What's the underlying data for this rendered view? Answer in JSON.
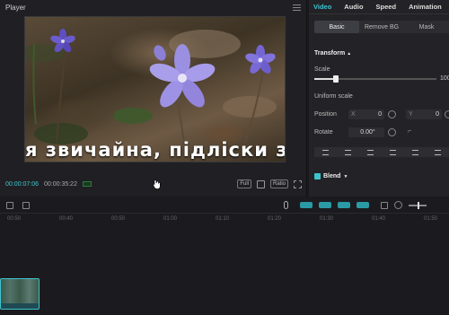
{
  "player": {
    "title": "Player",
    "subtitle": "я звичайна, підліски зв",
    "time_current": "00:00:07:06",
    "time_total": "00:00:35:22",
    "full_label": "Full",
    "ratio_label": "Ratio"
  },
  "inspector": {
    "tabs": [
      "Video",
      "Audio",
      "Speed",
      "Animation",
      "A"
    ],
    "subtabs": [
      "Basic",
      "Remove BG",
      "Mask"
    ],
    "transform_title": "Transform",
    "scale_label": "Scale",
    "scale_value": "100",
    "scale_fraction": 0.18,
    "uniform_scale_label": "Uniform scale",
    "position_label": "Position",
    "pos_x_label": "X",
    "pos_x_value": "0",
    "pos_y_label": "Y",
    "pos_y_value": "0",
    "rotate_label": "Rotate",
    "rotate_value": "0.00°",
    "blend_label": "Blend"
  },
  "timeline": {
    "ruler": [
      "00:50",
      "00:40",
      "00:50",
      "01:00",
      "01:10",
      "01:20",
      "01:30",
      "01:40",
      "01:50"
    ]
  },
  "colors": {
    "accent": "#3ec4cf",
    "background": "#1a1a1e"
  },
  "icons": [
    "menu-icon",
    "cursor-icon",
    "fit-icon",
    "fullscreen-icon",
    "mic-icon",
    "zoom-out-icon",
    "zoom-slider"
  ]
}
